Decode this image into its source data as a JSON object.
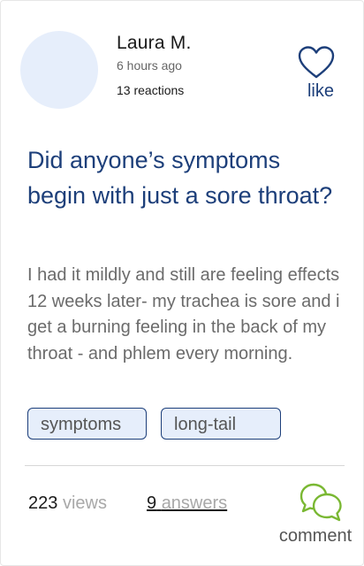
{
  "post": {
    "author": "Laura M.",
    "time": "6 hours ago",
    "reactions": "13 reactions",
    "like_label": "like",
    "title": "Did anyone’s symptoms begin with just a sore throat?",
    "body": "I had it mildly and still are feeling effects 12 weeks later- my trachea is sore and i get a burning feeling in the back of my throat - and phlem every morning.",
    "tags": [
      "symptoms",
      "long-tail"
    ]
  },
  "stats": {
    "views_count": "223",
    "views_label": "views",
    "answers_count": "9",
    "answers_label": "answers",
    "comment_label": "comment"
  },
  "icons": {
    "like": "heart-outline-icon",
    "comment": "speech-bubbles-icon"
  },
  "colors": {
    "accent": "#1d3f7a",
    "comment_green": "#7ab833",
    "tag_bg": "#e6eefb",
    "avatar_bg": "#e6eefb"
  }
}
